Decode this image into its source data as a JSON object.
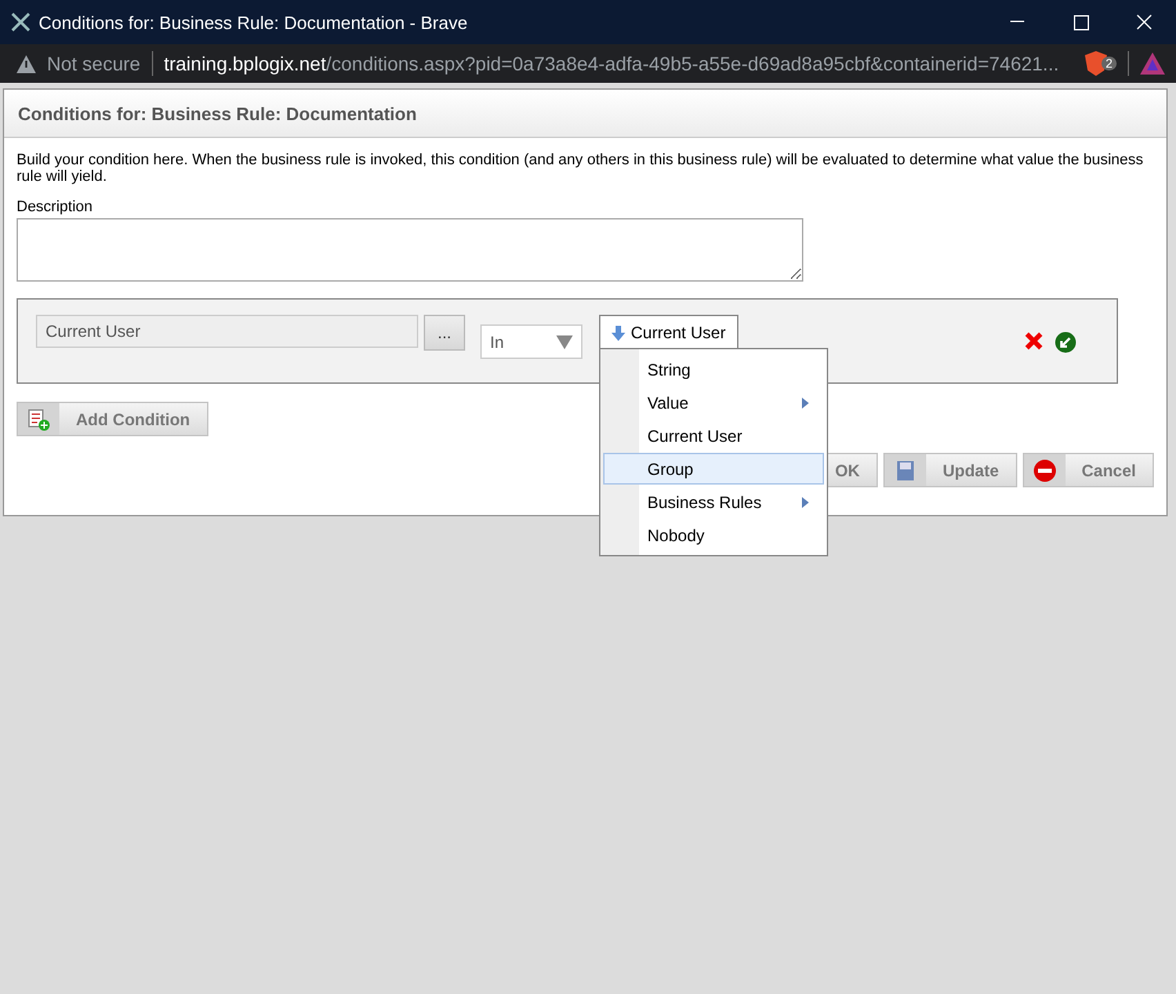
{
  "window": {
    "title": "Conditions for: Business Rule: Documentation - Brave"
  },
  "address_bar": {
    "security": "Not secure",
    "host": "training.bplogix.net",
    "path": "/conditions.aspx?pid=0a73a8e4-adfa-49b5-a55e-d69ad8a95cbf&containerid=74621...",
    "shield_count": "2"
  },
  "dialog": {
    "title": "Conditions for: Business Rule: Documentation",
    "intro": "Build your condition here. When the business rule is invoked, this condition (and any others in this business rule) will be evaluated to determine what value the business rule will yield.",
    "description_label": "Description",
    "condition": {
      "left_value": "Current User",
      "browse_label": "...",
      "operator": "In",
      "right_button": "Current User"
    },
    "menu": [
      {
        "label": "String",
        "submenu": false,
        "selected": false
      },
      {
        "label": "Value",
        "submenu": true,
        "selected": false
      },
      {
        "label": "Current User",
        "submenu": false,
        "selected": false
      },
      {
        "label": "Group",
        "submenu": false,
        "selected": true
      },
      {
        "label": "Business Rules",
        "submenu": true,
        "selected": false
      },
      {
        "label": "Nobody",
        "submenu": false,
        "selected": false
      }
    ],
    "add_condition": "Add Condition",
    "buttons": [
      {
        "kind": "ok",
        "label": "OK"
      },
      {
        "kind": "update",
        "label": "Update"
      },
      {
        "kind": "cancel",
        "label": "Cancel"
      }
    ]
  }
}
